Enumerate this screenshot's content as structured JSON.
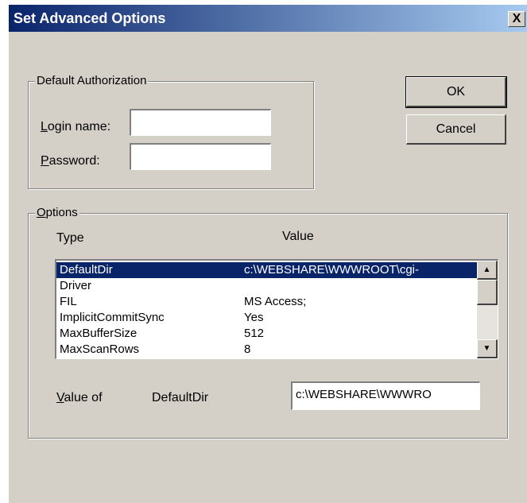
{
  "window": {
    "title": "Set Advanced Options",
    "close_glyph": "X"
  },
  "auth_group": {
    "legend": "Default Authorization",
    "login": {
      "label_first": "L",
      "label_rest": "ogin name:",
      "value": ""
    },
    "password": {
      "label_first": "P",
      "label_rest": "assword:",
      "value": ""
    }
  },
  "buttons": {
    "ok": "OK",
    "cancel": "Cancel"
  },
  "options_group": {
    "legend_first": "O",
    "legend_rest": "ptions",
    "col_type": "Type",
    "col_value": "Value",
    "rows": [
      {
        "type": "DefaultDir",
        "value": "c:\\WEBSHARE\\WWWROOT\\cgi-",
        "selected": true
      },
      {
        "type": "Driver",
        "value": ""
      },
      {
        "type": "FIL",
        "value": "MS Access;"
      },
      {
        "type": "ImplicitCommitSync",
        "value": "Yes"
      },
      {
        "type": "MaxBufferSize",
        "value": "512"
      },
      {
        "type": "MaxScanRows",
        "value": "8"
      }
    ],
    "value_of": {
      "label_first": "V",
      "label_rest": "alue of",
      "name": "DefaultDir",
      "field_value": "c:\\WEBSHARE\\WWWRO"
    }
  },
  "icons": {
    "scroll_up": "arrow-up-icon",
    "scroll_down": "arrow-down-icon"
  }
}
